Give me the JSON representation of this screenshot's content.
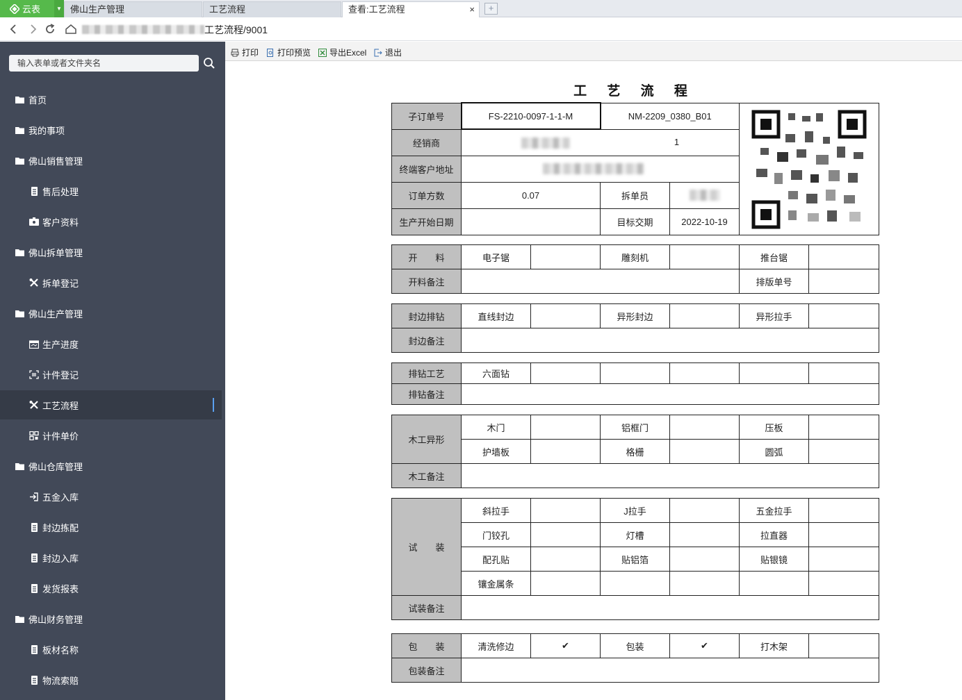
{
  "tabs": {
    "brand": "云表",
    "items": [
      {
        "label": "佛山生产管理"
      },
      {
        "label": "工艺流程"
      },
      {
        "label": "查看:工艺流程"
      }
    ],
    "close_glyph": "×",
    "newtab_glyph": "+"
  },
  "address": {
    "url_tail": "工艺流程/9001"
  },
  "sidebar": {
    "search_placeholder": "输入表单或者文件夹名",
    "items": [
      {
        "label": "首页",
        "level": 1,
        "icon": "folder-icon"
      },
      {
        "label": "我的事项",
        "level": 1,
        "icon": "folder-icon"
      },
      {
        "label": "佛山销售管理",
        "level": 1,
        "icon": "folder-icon"
      },
      {
        "label": "售后处理",
        "level": 2,
        "icon": "document-icon"
      },
      {
        "label": "客户资料",
        "level": 2,
        "icon": "id-card-icon"
      },
      {
        "label": "佛山拆单管理",
        "level": 1,
        "icon": "folder-icon"
      },
      {
        "label": "拆单登记",
        "level": 2,
        "icon": "tools-icon"
      },
      {
        "label": "佛山生产管理",
        "level": 1,
        "icon": "folder-icon"
      },
      {
        "label": "生产进度",
        "level": 2,
        "icon": "calendar-icon"
      },
      {
        "label": "计件登记",
        "level": 2,
        "icon": "scan-icon"
      },
      {
        "label": "工艺流程",
        "level": 2,
        "icon": "tools-icon",
        "active": true
      },
      {
        "label": "计件单价",
        "level": 2,
        "icon": "grid-icon"
      },
      {
        "label": "佛山仓库管理",
        "level": 1,
        "icon": "folder-icon"
      },
      {
        "label": "五金入库",
        "level": 2,
        "icon": "sign-in-icon"
      },
      {
        "label": "封边拣配",
        "level": 2,
        "icon": "document-icon"
      },
      {
        "label": "封边入库",
        "level": 2,
        "icon": "document-icon"
      },
      {
        "label": "发货报表",
        "level": 2,
        "icon": "document-icon"
      },
      {
        "label": "佛山财务管理",
        "level": 1,
        "icon": "folder-icon"
      },
      {
        "label": "板材名称",
        "level": 2,
        "icon": "document-icon"
      },
      {
        "label": "物流索赔",
        "level": 2,
        "icon": "document-icon"
      }
    ]
  },
  "toolbar": {
    "print": "打印",
    "preview": "打印预览",
    "excel": "导出Excel",
    "exit": "退出"
  },
  "report": {
    "title": "工 艺 流 程",
    "header": {
      "sub_order_label": "子订单号",
      "sub_order_no": "FS-2210-0097-1-1-M",
      "nm_code": "NM-2209_0380_B01",
      "dealer_label": "经销商",
      "dealer_suffix": "1",
      "address_label": "终端客户地址",
      "volume_label": "订单方数",
      "volume": "0.07",
      "splitter_label": "拆单员",
      "start_label": "生产开始日期",
      "start_date": "",
      "due_label": "目标交期",
      "due_date": "2022-10-19"
    },
    "cutting": {
      "label": "开　　料",
      "items": [
        "电子锯",
        "雕刻机",
        "推台锯"
      ],
      "note_label": "开料备注",
      "nest_label": "排版单号"
    },
    "edge": {
      "label": "封边排钻",
      "items": [
        "直线封边",
        "异形封边",
        "异形拉手"
      ],
      "note_label": "封边备注"
    },
    "drill": {
      "label": "排钻工艺",
      "items": [
        "六面钻"
      ],
      "note_label": "排钻备注"
    },
    "wood": {
      "label": "木工异形",
      "row1": [
        "木门",
        "铝框门",
        "压板"
      ],
      "row2": [
        "护墙板",
        "格栅",
        "圆弧"
      ],
      "note_label": "木工备注"
    },
    "fit": {
      "label": "试　　装",
      "row1": [
        "斜拉手",
        "J拉手",
        "五金拉手"
      ],
      "row2": [
        "门铰孔",
        "灯槽",
        "拉直器"
      ],
      "row3": [
        "配孔贴",
        "贴铝箔",
        "贴银镜"
      ],
      "row4": [
        "镶金属条"
      ],
      "note_label": "试装备注"
    },
    "pack": {
      "label": "包　　装",
      "items": [
        "清洗修边",
        "包装",
        "打木架"
      ],
      "checks": [
        "✔",
        "✔"
      ],
      "note_label": "包装备注"
    }
  }
}
